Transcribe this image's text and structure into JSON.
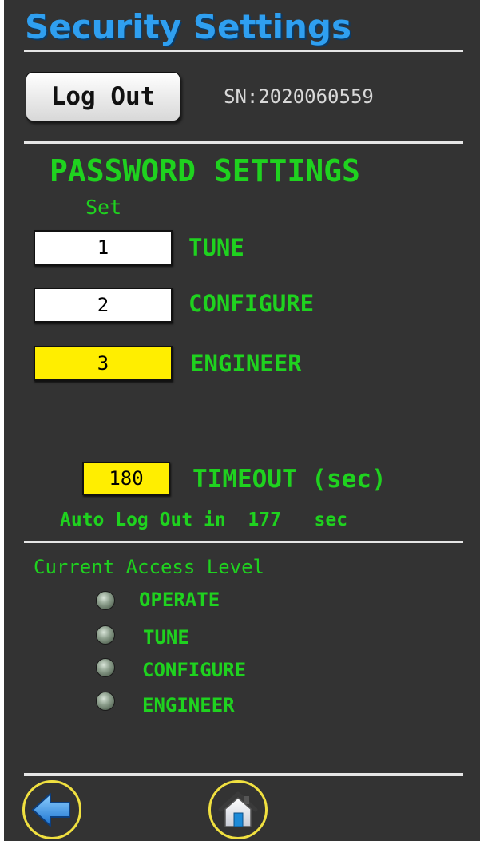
{
  "header": {
    "title": "Security Settings",
    "logout_label": "Log Out",
    "serial": "SN:2020060559"
  },
  "passwords": {
    "heading": "PASSWORD SETTINGS",
    "set_label": "Set",
    "rows": [
      {
        "value": "1",
        "label": "TUNE",
        "highlighted": false
      },
      {
        "value": "2",
        "label": "CONFIGURE",
        "highlighted": false
      },
      {
        "value": "3",
        "label": "ENGINEER",
        "highlighted": true
      }
    ]
  },
  "timeout": {
    "value": "180",
    "label": "TIMEOUT (sec)",
    "auto_prefix": "Auto Log Out in",
    "remaining": "177",
    "unit": "sec"
  },
  "access": {
    "title": "Current Access Level",
    "levels": [
      "OPERATE",
      "TUNE",
      "CONFIGURE",
      "ENGINEER"
    ]
  },
  "nav": {
    "back_icon": "back-arrow-icon",
    "home_icon": "home-icon"
  },
  "colors": {
    "background": "#333333",
    "title_blue": "#2f9ff0",
    "label_green": "#1fd21f",
    "field_yellow": "#ffee00",
    "nav_ring": "#f0e040"
  }
}
